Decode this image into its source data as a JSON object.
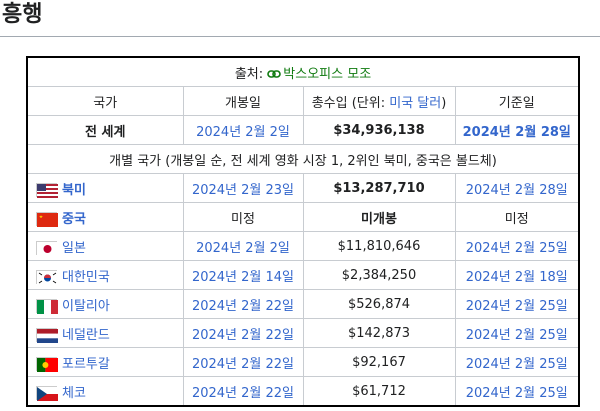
{
  "heading": "흥행",
  "source": {
    "label": "출처:",
    "link": "박스오피스 모조"
  },
  "columns": {
    "country": "국가",
    "release": "개봉일",
    "gross": "총수입 (단위:",
    "gross_unit": "미국 달러",
    "gross_close": ")",
    "as_of": "기준일"
  },
  "world": {
    "country": "전 세계",
    "release": "2024년 2월 2일",
    "gross": "$34,936,138",
    "as_of": "2024년 2월 28일"
  },
  "individual_note": "개별 국가 (개봉일 순, 전 세계 영화 시장 1, 2위인 북미, 중국은 볼드체)",
  "rows": [
    {
      "country": "북미",
      "release": "2024년 2월 23일",
      "gross": "$13,287,710",
      "as_of": "2024년 2월 28일",
      "flag": "us"
    },
    {
      "country": "중국",
      "release": "미정",
      "gross": "미개봉",
      "as_of": "미정",
      "flag": "cn"
    },
    {
      "country": "일본",
      "release": "2024년 2월 2일",
      "gross": "$11,810,646",
      "as_of": "2024년 2월 25일",
      "flag": "jp"
    },
    {
      "country": "대한민국",
      "release": "2024년 2월 14일",
      "gross": "$2,384,250",
      "as_of": "2024년 2월 18일",
      "flag": "kr"
    },
    {
      "country": "이탈리아",
      "release": "2024년 2월 22일",
      "gross": "$526,874",
      "as_of": "2024년 2월 25일",
      "flag": "it"
    },
    {
      "country": "네덜란드",
      "release": "2024년 2월 22일",
      "gross": "$142,873",
      "as_of": "2024년 2월 25일",
      "flag": "nl"
    },
    {
      "country": "포르투갈",
      "release": "2024년 2월 22일",
      "gross": "$92,167",
      "as_of": "2024년 2월 25일",
      "flag": "pt"
    },
    {
      "country": "체코",
      "release": "2024년 2월 22일",
      "gross": "$61,712",
      "as_of": "2024년 2월 25일",
      "flag": "cz"
    }
  ]
}
